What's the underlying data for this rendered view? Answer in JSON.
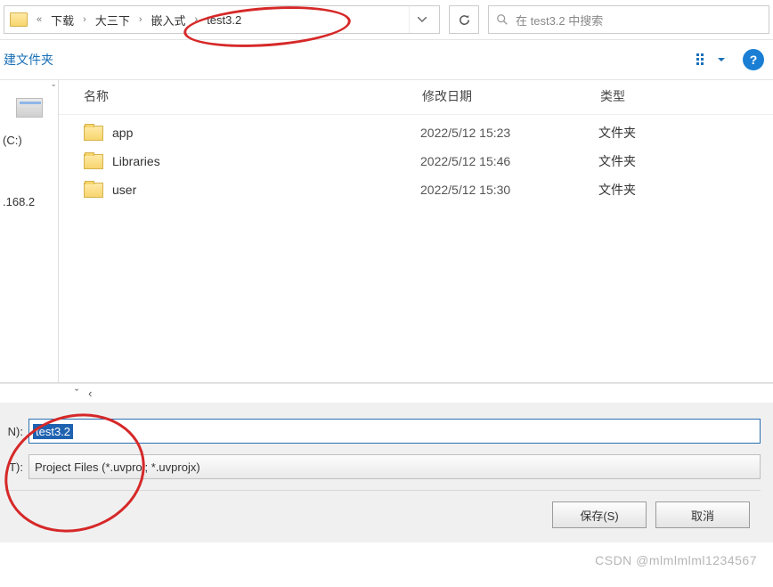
{
  "breadcrumb": {
    "items": [
      "下载",
      "大三下",
      "嵌入式",
      "test3.2"
    ]
  },
  "search": {
    "placeholder": "在 test3.2 中搜索"
  },
  "sub_toolbar": {
    "new_folder": "建文件夹"
  },
  "sidebar": {
    "drive_label": "(C:)",
    "network_label": ".168.2"
  },
  "headers": {
    "name": "名称",
    "date": "修改日期",
    "type": "类型"
  },
  "rows": [
    {
      "name": "app",
      "date": "2022/5/12 15:23",
      "type": "文件夹"
    },
    {
      "name": "Libraries",
      "date": "2022/5/12 15:46",
      "type": "文件夹"
    },
    {
      "name": "user",
      "date": "2022/5/12 15:30",
      "type": "文件夹"
    }
  ],
  "form": {
    "name_label": "N):",
    "name_value": "test3.2",
    "type_label": "T):",
    "type_value": "Project Files (*.uvproj; *.uvprojx)"
  },
  "actions": {
    "save": "保存(S)",
    "cancel": "取消"
  },
  "watermark": "CSDN @mlmlmlml1234567"
}
